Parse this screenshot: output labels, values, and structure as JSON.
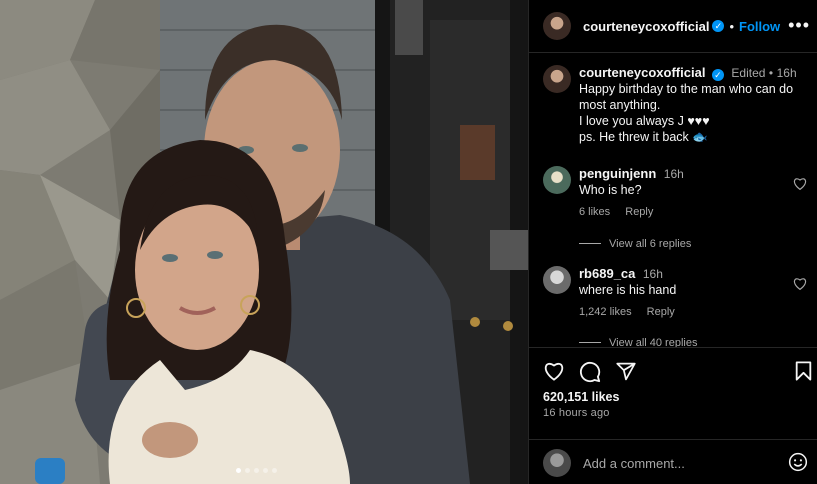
{
  "post": {
    "username": "courteneycoxofficial",
    "follow_label": "Follow",
    "separator": "•",
    "more_label": "•••",
    "carousel": {
      "count": 5,
      "active_index": 0
    }
  },
  "caption": {
    "username": "courteneycoxofficial",
    "edited": "Edited",
    "time": "16h",
    "lines": [
      "Happy birthday to the man who can do most anything.",
      "I love you always J ♥♥♥",
      "ps. He threw it back 🐟"
    ]
  },
  "comments": [
    {
      "username": "penguinjenn",
      "time": "16h",
      "text": "Who is he?",
      "likes": "6 likes",
      "reply_label": "Reply",
      "view_replies": "View all 6 replies"
    },
    {
      "username": "rb689_ca",
      "time": "16h",
      "text": "where is his hand",
      "likes": "1,242 likes",
      "reply_label": "Reply",
      "view_replies": "View all 40 replies"
    }
  ],
  "stats": {
    "likes": "620,151 likes",
    "posted": "16 hours ago"
  },
  "add_comment": {
    "placeholder": "Add a comment..."
  },
  "icons": {
    "like": "heart-icon",
    "comment": "comment-icon",
    "share": "share-icon",
    "save": "bookmark-icon",
    "emoji": "emoji-icon",
    "verified": "verified-badge-icon"
  },
  "colors": {
    "accent": "#0095f6",
    "background": "#000000",
    "muted": "#a8a8a8"
  }
}
